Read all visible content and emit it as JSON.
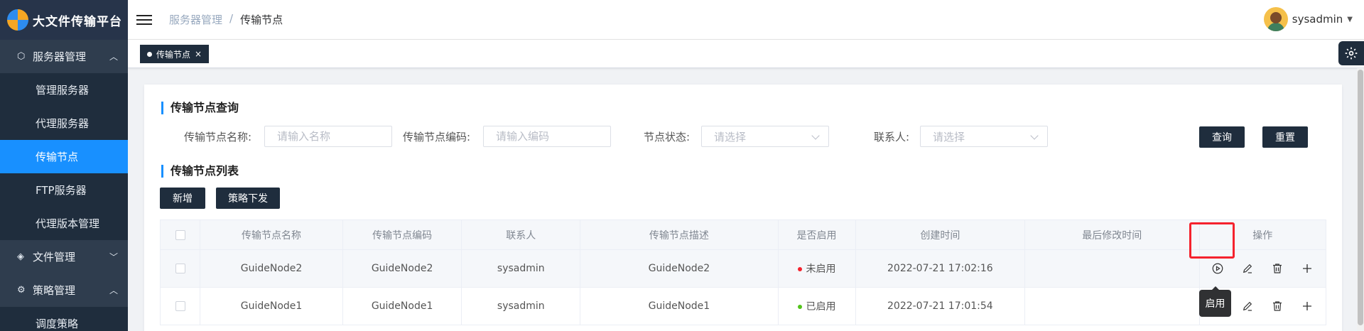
{
  "app": {
    "title": "大文件传输平台"
  },
  "sidebar": {
    "groups": [
      {
        "label": "服务器管理",
        "icon": "cube-icon",
        "expanded": true,
        "items": [
          {
            "label": "管理服务器",
            "active": false
          },
          {
            "label": "代理服务器",
            "active": false
          },
          {
            "label": "传输节点",
            "active": true
          },
          {
            "label": "FTP服务器",
            "active": false
          },
          {
            "label": "代理版本管理",
            "active": false
          }
        ]
      },
      {
        "label": "文件管理",
        "icon": "layers-icon",
        "expanded": false
      },
      {
        "label": "策略管理",
        "icon": "gear-icon",
        "expanded": true,
        "items": [
          {
            "label": "调度策略",
            "active": false
          }
        ]
      }
    ]
  },
  "header": {
    "breadcrumb": [
      "服务器管理",
      "/",
      "传输节点"
    ],
    "user": {
      "name": "sysadmin"
    }
  },
  "tabs": [
    {
      "label": "传输节点",
      "close": "×"
    }
  ],
  "query": {
    "title": "传输节点查询",
    "fields": [
      {
        "label": "传输节点名称:",
        "placeholder": "请输入名称"
      },
      {
        "label": "传输节点编码:",
        "placeholder": "请输入编码"
      },
      {
        "label": "节点状态:",
        "placeholder": "请选择"
      },
      {
        "label": "联系人:",
        "placeholder": "请选择"
      }
    ],
    "search_button": "查询",
    "reset_button": "重置"
  },
  "list": {
    "title": "传输节点列表",
    "add_button": "新增",
    "dispatch_button": "策略下发",
    "columns": [
      "传输节点名称",
      "传输节点编码",
      "联系人",
      "传输节点描述",
      "是否启用",
      "创建时间",
      "最后修改时间",
      "操作"
    ],
    "rows": [
      {
        "name": "GuideNode2",
        "code": "GuideNode2",
        "contact": "sysadmin",
        "description": "GuideNode2",
        "status": "未启用",
        "status_color": "#f5222d",
        "created": "2022-07-21 17:02:16",
        "modified": ""
      },
      {
        "name": "GuideNode1",
        "code": "GuideNode1",
        "contact": "sysadmin",
        "description": "GuideNode1",
        "status": "已启用",
        "status_color": "#52c41a",
        "created": "2022-07-21 17:01:54",
        "modified": ""
      }
    ],
    "tooltip": "启用"
  },
  "colors": {
    "sidebar_bg": "#2f3d4e",
    "active": "#1890ff",
    "button_dark": "#1f2d3d",
    "highlight": "#f5222d"
  }
}
